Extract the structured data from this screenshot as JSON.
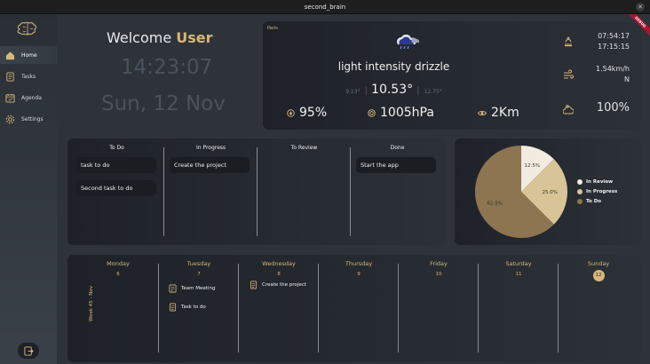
{
  "window": {
    "title": "second_brain",
    "debug_banner": "DEBUG"
  },
  "sidebar": {
    "items": [
      {
        "label": "Home",
        "icon": "home-icon"
      },
      {
        "label": "Tasks",
        "icon": "tasks-icon"
      },
      {
        "label": "Agenda",
        "icon": "agenda-icon"
      },
      {
        "label": "Settings",
        "icon": "settings-icon"
      }
    ],
    "active": "Home",
    "bottom_icon": "logout-icon"
  },
  "greeting": {
    "prefix": "Welcome ",
    "user": "User"
  },
  "clock": {
    "time": "14:23:07",
    "date": "Sun, 12 Nov"
  },
  "weather": {
    "city": "Paris",
    "description": "light intensity drizzle",
    "temp_min": "9.13°",
    "temp": "10.53°",
    "temp_max": "12.75°",
    "humidity": "95%",
    "pressure": "1005hPa",
    "visibility": "2Km",
    "sunrise": "07:54:17",
    "sunset": "17:15:15",
    "wind_speed": "1.54km/h",
    "wind_dir": "N",
    "clouds": "100%"
  },
  "kanban": {
    "columns": [
      {
        "title": "To Do",
        "tasks": [
          "task to do",
          "Second task to do"
        ]
      },
      {
        "title": "In Progress",
        "tasks": [
          "Create the project"
        ]
      },
      {
        "title": "To Review",
        "tasks": []
      },
      {
        "title": "Done",
        "tasks": [
          "Start the app"
        ]
      }
    ]
  },
  "chart_data": {
    "type": "pie",
    "slices": [
      {
        "label": "In Review",
        "value": 12.5,
        "display": "12.5%",
        "color": "#f2ebe0"
      },
      {
        "label": "In Progress",
        "value": 25.0,
        "display": "25.0%",
        "color": "#d8c497"
      },
      {
        "label": "To Do",
        "value": 62.5,
        "display": "62.5%",
        "color": "#8c7550"
      }
    ],
    "legend": [
      "In Review",
      "In Progress",
      "To Do"
    ],
    "legend_position": "right"
  },
  "week": {
    "label": "Week 45 - Nov",
    "days": [
      {
        "name": "Monday",
        "num": "6",
        "events": []
      },
      {
        "name": "Tuesday",
        "num": "7",
        "events": [
          {
            "label": "Team Meeting",
            "icon": "meeting-icon"
          },
          {
            "label": "Task to do",
            "icon": "task-icon"
          }
        ]
      },
      {
        "name": "Wednesday",
        "num": "8",
        "events": [
          {
            "label": "Create the project",
            "icon": "task-icon"
          }
        ]
      },
      {
        "name": "Thursday",
        "num": "9",
        "events": []
      },
      {
        "name": "Friday",
        "num": "10",
        "events": []
      },
      {
        "name": "Saturday",
        "num": "11",
        "events": []
      },
      {
        "name": "Sunday",
        "num": "12",
        "events": [],
        "today": true
      }
    ]
  },
  "colors": {
    "accent": "#d8b67a",
    "background": "#2e333a",
    "card": "#1e2228"
  }
}
